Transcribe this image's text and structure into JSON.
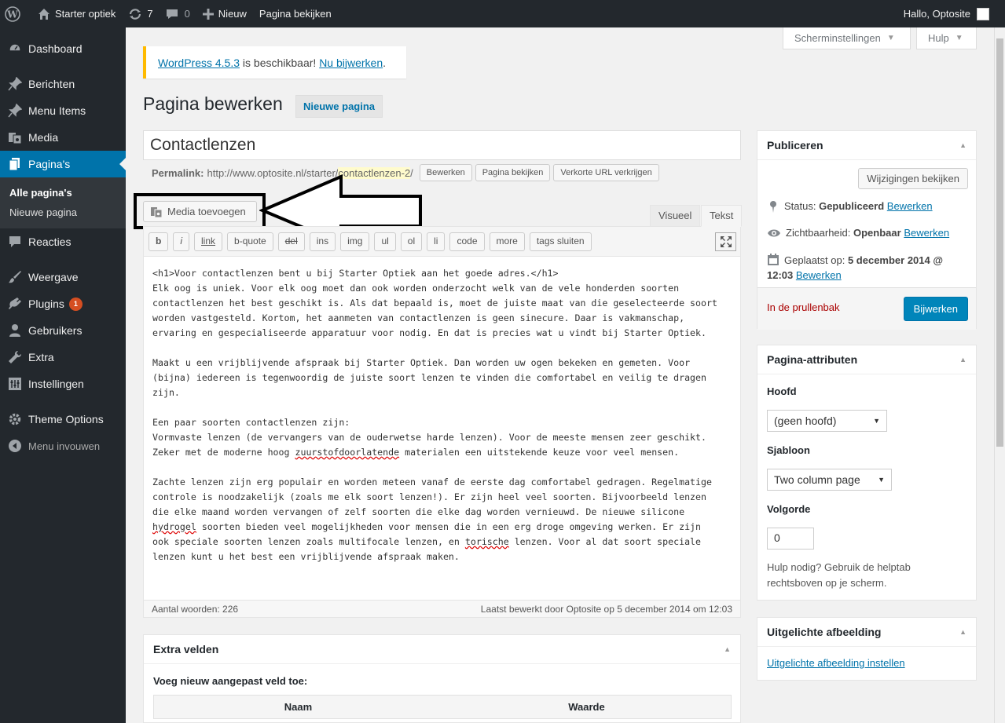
{
  "adminbar": {
    "site_name": "Starter optiek",
    "updates_count": "7",
    "comments_count": "0",
    "new_label": "Nieuw",
    "view_page_label": "Pagina bekijken",
    "greeting": "Hallo, Optosite"
  },
  "sidebar": {
    "dashboard": "Dashboard",
    "berichten": "Berichten",
    "menu_items": "Menu Items",
    "media": "Media",
    "paginas": "Pagina's",
    "sub_all": "Alle pagina's",
    "sub_new": "Nieuwe pagina",
    "reacties": "Reacties",
    "weergave": "Weergave",
    "plugins": "Plugins",
    "plugins_badge": "1",
    "gebruikers": "Gebruikers",
    "extra": "Extra",
    "instellingen": "Instellingen",
    "theme_options": "Theme Options",
    "collapse": "Menu invouwen"
  },
  "screen_meta": {
    "screen_options": "Scherminstellingen",
    "help": "Hulp"
  },
  "notice": {
    "link1": "WordPress 4.5.3",
    "middle": " is beschikbaar! ",
    "link2": "Nu bijwerken",
    "end": "."
  },
  "page": {
    "heading": "Pagina bewerken",
    "add_new": "Nieuwe pagina",
    "title_value": "Contactlenzen",
    "permalink_label": "Permalink:",
    "permalink_base": "http://www.optosite.nl/starter/",
    "permalink_slug": "contactlenzen-2",
    "permalink_end": "/",
    "btn_edit": "Bewerken",
    "btn_view": "Pagina bekijken",
    "btn_shortlink": "Verkorte URL verkrijgen"
  },
  "editor": {
    "media_button": "Media toevoegen",
    "tab_visual": "Visueel",
    "tab_text": "Tekst",
    "quicktags": [
      "b",
      "i",
      "link",
      "b-quote",
      "del",
      "ins",
      "img",
      "ul",
      "ol",
      "li",
      "code",
      "more",
      "tags sluiten"
    ],
    "word_count": "Aantal woorden: 226",
    "last_edited": "Laatst bewerkt door Optosite op 5 december 2014 om 12:03",
    "content": {
      "p1a": "<h1>Voor contactlenzen bent u bij Starter Optiek aan het goede adres.</h1>",
      "p1b": "Elk oog is uniek. Voor elk oog moet dan ook worden onderzocht welk van de vele honderden soorten",
      "p1c": "contactlenzen het best geschikt is. Als dat bepaald is, moet de juiste maat van die geselecteerde soort",
      "p1d": "worden vastgesteld. Kortom, het aanmeten van contactlenzen is geen sinecure. Daar is vakmanschap,",
      "p1e": "ervaring en gespecialiseerde apparatuur voor nodig. En dat is precies wat u vindt bij Starter Optiek.",
      "p2a": "Maakt u een vrijblijvende afspraak bij Starter Optiek. Dan worden uw ogen bekeken en gemeten. Voor",
      "p2b": "(bijna) iedereen is tegenwoordig de juiste soort lenzen te vinden die comfortabel en veilig te dragen",
      "p2c": "zijn.",
      "p3a": "Een paar soorten contactlenzen zijn:",
      "p3b": "Vormvaste lenzen (de vervangers van de ouderwetse harde lenzen). Voor de meeste mensen zeer geschikt.",
      "p3c_pre": "Zeker met de moderne hoog ",
      "p3c_sq": "zuurstofdoorlatende",
      "p3c_post": " materialen een uitstekende keuze voor veel mensen.",
      "p4a": "Zachte lenzen zijn erg populair en worden meteen vanaf de eerste dag comfortabel gedragen. Regelmatige",
      "p4b": "controle is noodzakelijk (zoals me elk soort lenzen!). Er zijn heel veel soorten. Bijvoorbeeld lenzen",
      "p4c": "die elke maand worden vervangen of zelf soorten die elke dag worden vernieuwd. De nieuwe silicone",
      "p4d_sq": "hydrogel",
      "p4d_post": " soorten bieden veel mogelijkheden voor mensen die in een erg droge omgeving werken. Er zijn",
      "p4e_pre": "ook speciale soorten lenzen zoals multifocale lenzen, en ",
      "p4e_sq": "torische",
      "p4e_post": " lenzen. Voor al dat soort speciale",
      "p4f": "lenzen kunt u het best een vrijblijvende afspraak maken."
    }
  },
  "extra_fields": {
    "title": "Extra velden",
    "subtitle": "Voeg nieuw aangepast veld toe:",
    "col_name": "Naam",
    "col_value": "Waarde"
  },
  "publish": {
    "title": "Publiceren",
    "preview_changes": "Wijzigingen bekijken",
    "status_label": "Status: ",
    "status_value": "Gepubliceerd",
    "visibility_label": "Zichtbaarheid: ",
    "visibility_value": "Openbaar",
    "published_label": "Geplaatst op: ",
    "published_value": "5 december 2014 @",
    "published_value2": "12:03",
    "edit_link": "Bewerken",
    "trash": "In de prullenbak",
    "update": "Bijwerken"
  },
  "page_attributes": {
    "title": "Pagina-attributen",
    "parent_label": "Hoofd",
    "parent_value": "(geen hoofd)",
    "template_label": "Sjabloon",
    "template_value": "Two column page",
    "order_label": "Volgorde",
    "order_value": "0",
    "help_text": "Hulp nodig? Gebruik de helptab rechtsboven op je scherm."
  },
  "featured_image": {
    "title": "Uitgelichte afbeelding",
    "set_link": "Uitgelichte afbeelding instellen"
  },
  "colors": {
    "accent": "#0073aa",
    "primary_button": "#0085ba",
    "notice_border": "#ffba00",
    "admin_dark": "#23282d"
  }
}
